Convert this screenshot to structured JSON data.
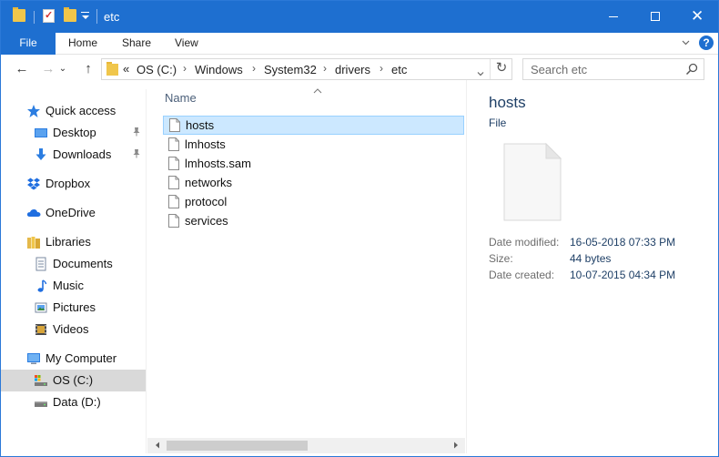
{
  "window": {
    "title": "etc",
    "controls": {
      "minimize": "minimize",
      "maximize": "maximize",
      "close": "✕"
    }
  },
  "ribbon": {
    "tabs": [
      {
        "label": "File"
      },
      {
        "label": "Home"
      },
      {
        "label": "Share"
      },
      {
        "label": "View"
      }
    ],
    "help": "?"
  },
  "navigation": {
    "back": "←",
    "forward": "→",
    "dropdown": "⌄",
    "up": "↑",
    "refresh": "↻"
  },
  "address": {
    "overflow": "«",
    "separator": "›",
    "crumbs": [
      "OS (C:)",
      "Windows",
      "System32",
      "drivers",
      "etc"
    ]
  },
  "search": {
    "placeholder": "Search etc"
  },
  "nav_pane": {
    "items": [
      {
        "label": "Quick access",
        "icon": "star-icon"
      },
      {
        "label": "Desktop",
        "icon": "desktop-icon",
        "pinned": true
      },
      {
        "label": "Downloads",
        "icon": "downloads-icon",
        "pinned": true
      },
      {
        "label": "Dropbox",
        "icon": "dropbox-icon"
      },
      {
        "label": "OneDrive",
        "icon": "cloud-icon"
      },
      {
        "label": "Libraries",
        "icon": "libraries-icon"
      },
      {
        "label": "Documents",
        "icon": "documents-icon"
      },
      {
        "label": "Music",
        "icon": "music-icon"
      },
      {
        "label": "Pictures",
        "icon": "pictures-icon"
      },
      {
        "label": "Videos",
        "icon": "videos-icon"
      },
      {
        "label": "My Computer",
        "icon": "computer-icon"
      },
      {
        "label": "OS (C:)",
        "icon": "os-drive-icon",
        "selected": true
      },
      {
        "label": "Data (D:)",
        "icon": "drive-icon"
      }
    ],
    "pin_glyph": "📌"
  },
  "file_list": {
    "column_header": "Name",
    "files": [
      {
        "name": "hosts",
        "selected": true
      },
      {
        "name": "lmhosts"
      },
      {
        "name": "lmhosts.sam"
      },
      {
        "name": "networks"
      },
      {
        "name": "protocol"
      },
      {
        "name": "services"
      }
    ]
  },
  "details": {
    "name": "hosts",
    "type": "File",
    "properties": [
      {
        "label": "Date modified:",
        "value": "16-05-2018 07:33 PM"
      },
      {
        "label": "Size:",
        "value": "44 bytes"
      },
      {
        "label": "Date created:",
        "value": "10-07-2015 04:34 PM"
      }
    ]
  },
  "colors": {
    "accent": "#1e6fd0",
    "selection": "#cce8ff",
    "nav_selected": "#d9d9d9",
    "folder": "#f0c64b"
  }
}
